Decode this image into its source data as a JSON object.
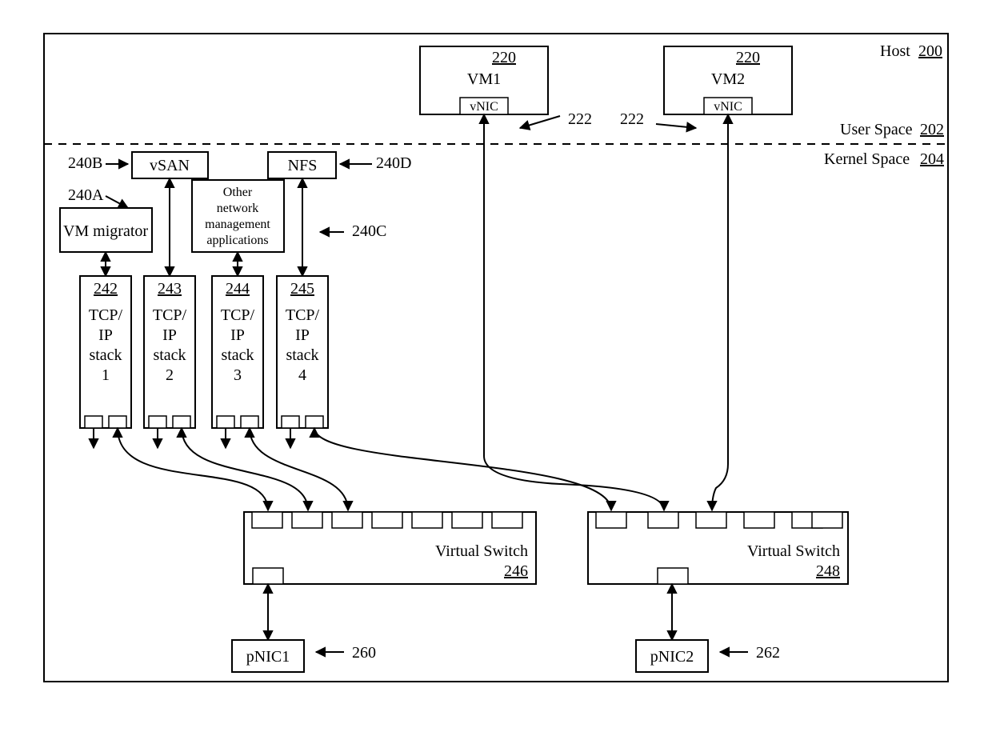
{
  "frame": {
    "host_label": "Host",
    "host_ref": "200",
    "user_space_label": "User Space",
    "user_space_ref": "202",
    "kernel_space_label": "Kernel Space",
    "kernel_space_ref": "204"
  },
  "vms": {
    "vm1": {
      "name": "VM1",
      "ref": "220",
      "vnic": "vNIC",
      "callout": "222"
    },
    "vm2": {
      "name": "VM2",
      "ref": "220",
      "vnic": "vNIC",
      "callout": "222"
    }
  },
  "kernel_apps": {
    "vsan": {
      "label": "vSAN",
      "callout": "240B"
    },
    "nfs": {
      "label": "NFS",
      "callout": "240D"
    },
    "vm_migrator": {
      "label": "VM migrator",
      "callout": "240A"
    },
    "other": {
      "line1": "Other",
      "line2": "network",
      "line3": "management",
      "line4": "applications",
      "callout": "240C"
    }
  },
  "stacks": {
    "s1": {
      "ref": "242",
      "l1": "TCP/",
      "l2": "IP",
      "l3": "stack",
      "l4": "1"
    },
    "s2": {
      "ref": "243",
      "l1": "TCP/",
      "l2": "IP",
      "l3": "stack",
      "l4": "2"
    },
    "s3": {
      "ref": "244",
      "l1": "TCP/",
      "l2": "IP",
      "l3": "stack",
      "l4": "3"
    },
    "s4": {
      "ref": "245",
      "l1": "TCP/",
      "l2": "IP",
      "l3": "stack",
      "l4": "4"
    }
  },
  "switches": {
    "sw1": {
      "label": "Virtual Switch",
      "ref": "246"
    },
    "sw2": {
      "label": "Virtual Switch",
      "ref": "248"
    }
  },
  "pnics": {
    "p1": {
      "label": "pNIC1",
      "callout": "260"
    },
    "p2": {
      "label": "pNIC2",
      "callout": "262"
    }
  }
}
